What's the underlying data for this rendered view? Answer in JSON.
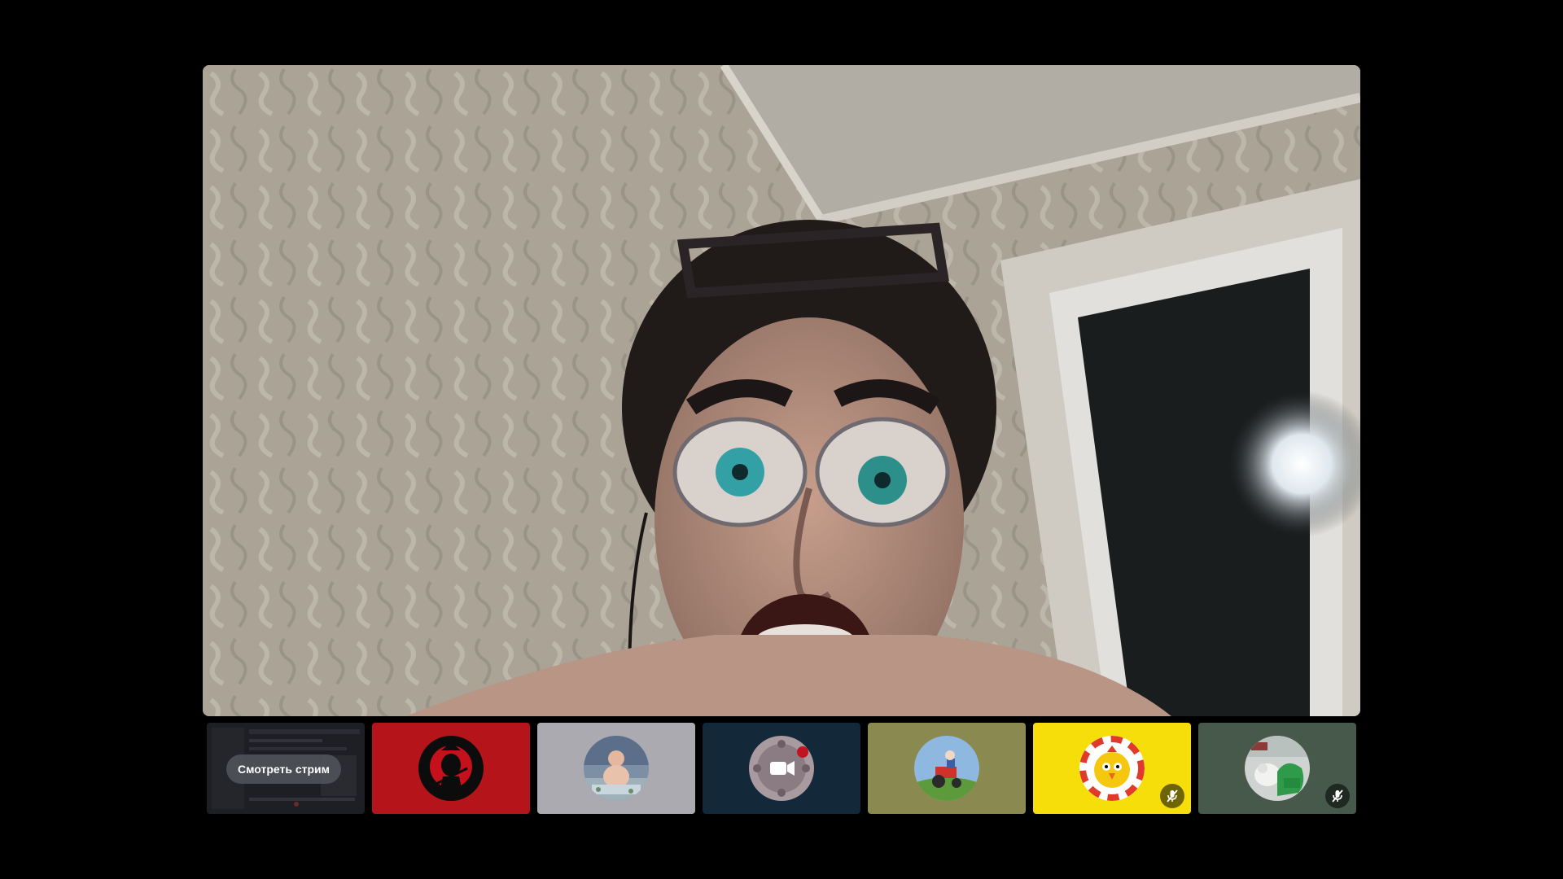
{
  "stream_tile": {
    "watch_label": "Смотреть стрим"
  },
  "participants": [
    {
      "avatar": "samurai-avatar-icon",
      "tile_color": "#b5141b",
      "muted": false
    },
    {
      "avatar": "baby-avatar-icon",
      "tile_color": "#acaab1",
      "muted": false
    },
    {
      "avatar": "video-camera-avatar-icon",
      "tile_color": "#13293a",
      "muted": false
    },
    {
      "avatar": "tractor-avatar-icon",
      "tile_color": "#8a8a50",
      "muted": false
    },
    {
      "avatar": "chick-avatar-icon",
      "tile_color": "#f6de0b",
      "muted": true
    },
    {
      "avatar": "sheep-avatar-icon",
      "tile_color": "#46594b",
      "muted": true
    }
  ],
  "colors": {
    "background": "#000000",
    "stream_button_bg": "#4e5058"
  }
}
